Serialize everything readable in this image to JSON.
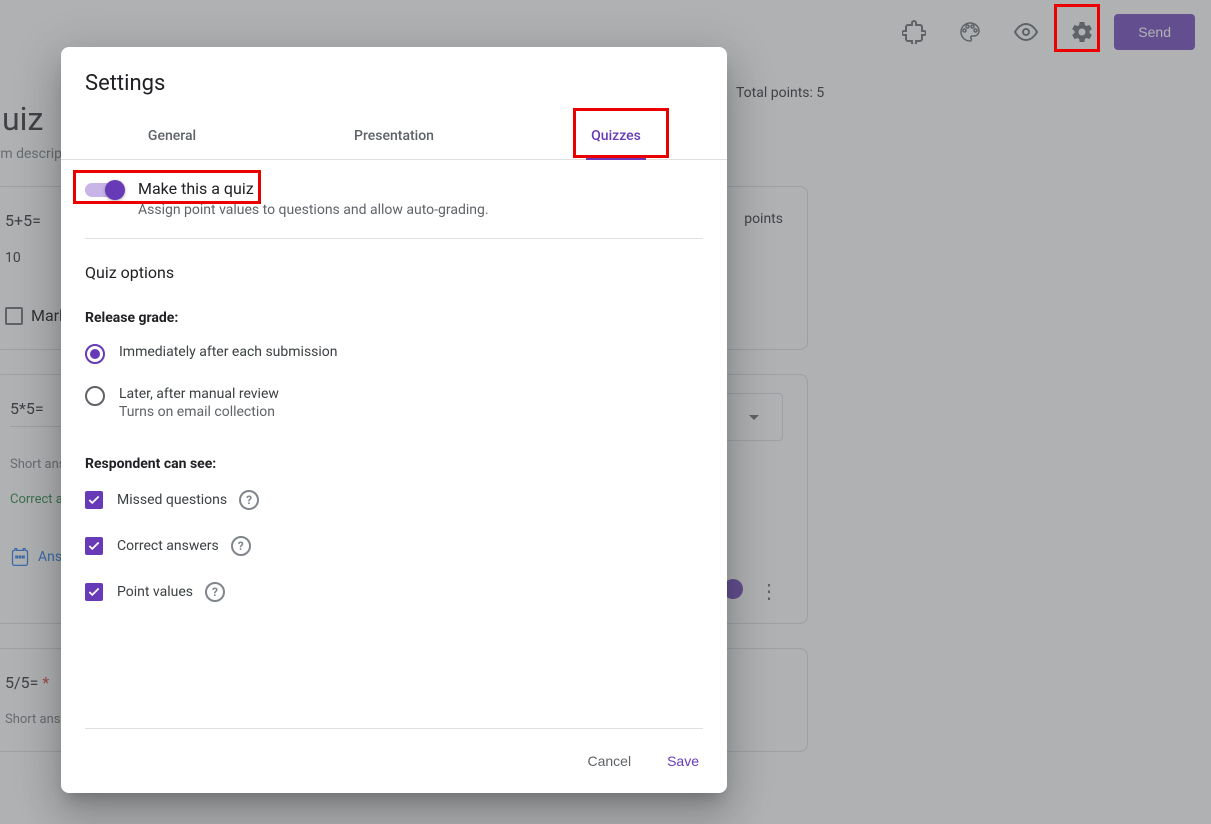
{
  "header": {
    "send_label": "Send",
    "total_points": "Total points: 5"
  },
  "background": {
    "title": "Quiz",
    "description": "Form description",
    "q1": {
      "text": "5+5=",
      "answer": "10",
      "mark": "Mark as incorrect",
      "points_label": "points"
    },
    "q2": {
      "text": "5*5=",
      "short": "Short answer text",
      "correct": "Correct answer",
      "answer_key": "Answer key"
    },
    "q3": {
      "text": "5/5=",
      "star": "*",
      "short": "Short answer text"
    }
  },
  "dialog": {
    "title": "Settings",
    "tabs": {
      "general": "General",
      "presentation": "Presentation",
      "quizzes": "Quizzes"
    },
    "quiz_toggle": {
      "label": "Make this a quiz",
      "sub": "Assign point values to questions and allow auto-grading."
    },
    "quiz_options_heading": "Quiz options",
    "release_grade": {
      "heading": "Release grade:",
      "immediate": "Immediately after each submission",
      "later": "Later, after manual review",
      "later_sub": "Turns on email collection"
    },
    "respondent": {
      "heading": "Respondent can see:",
      "missed": "Missed questions",
      "correct": "Correct answers",
      "points": "Point values"
    },
    "footer": {
      "cancel": "Cancel",
      "save": "Save"
    }
  }
}
